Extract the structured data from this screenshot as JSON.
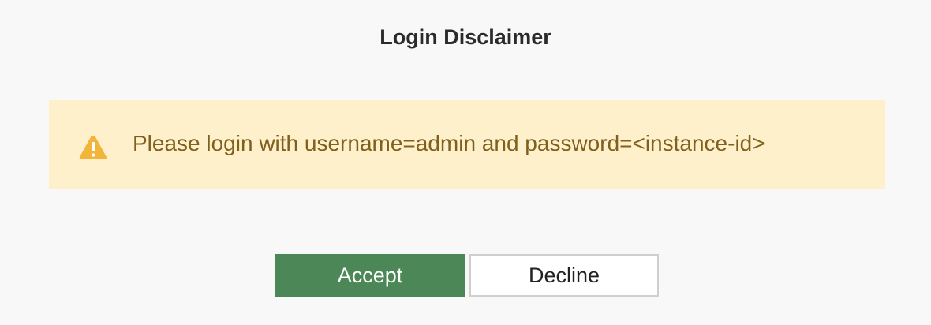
{
  "dialog": {
    "title": "Login Disclaimer"
  },
  "notice": {
    "icon": "warning-icon",
    "icon_color": "#f0b53a",
    "background_color": "#fef0cb",
    "text_color": "#80601d",
    "message": "Please login with username=admin and password=<instance-id>"
  },
  "actions": {
    "accept_label": "Accept",
    "accept_color": "#4c8757",
    "decline_label": "Decline"
  }
}
